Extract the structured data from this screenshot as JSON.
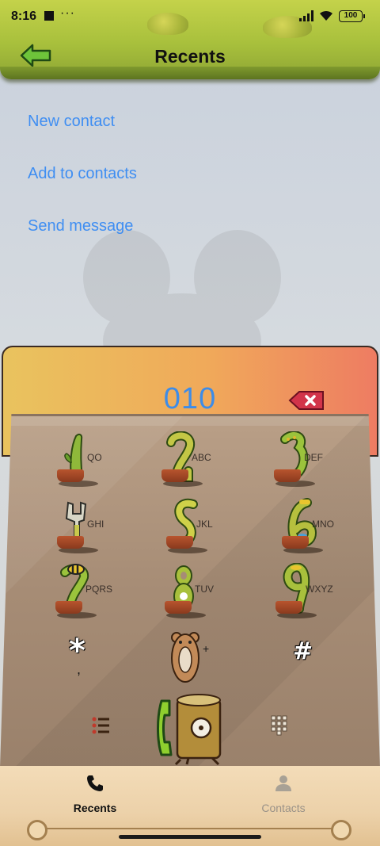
{
  "status": {
    "time": "8:16",
    "dots": "···",
    "battery": "100"
  },
  "header": {
    "title": "Recents",
    "back_icon": "back-arrow-icon"
  },
  "actions": [
    "New contact",
    "Add to contacts",
    "Send message"
  ],
  "dialer": {
    "number": "010",
    "keys": [
      {
        "digit": "1",
        "letters": "QO"
      },
      {
        "digit": "2",
        "letters": "ABC"
      },
      {
        "digit": "3",
        "letters": "DEF"
      },
      {
        "digit": "4",
        "letters": "GHI"
      },
      {
        "digit": "5",
        "letters": "JKL"
      },
      {
        "digit": "6",
        "letters": "MNO"
      },
      {
        "digit": "7",
        "letters": "PQRS"
      },
      {
        "digit": "8",
        "letters": "TUV"
      },
      {
        "digit": "9",
        "letters": "WXYZ"
      }
    ],
    "star": "*",
    "star_sub": ",",
    "zero_sub": "+",
    "hash": "#"
  },
  "nav": {
    "recents": "Recents",
    "contacts": "Contacts"
  },
  "colors": {
    "accent_blue": "#3f8ef2",
    "header_green": "#a8c03c",
    "plant_green": "#8fb83a"
  }
}
